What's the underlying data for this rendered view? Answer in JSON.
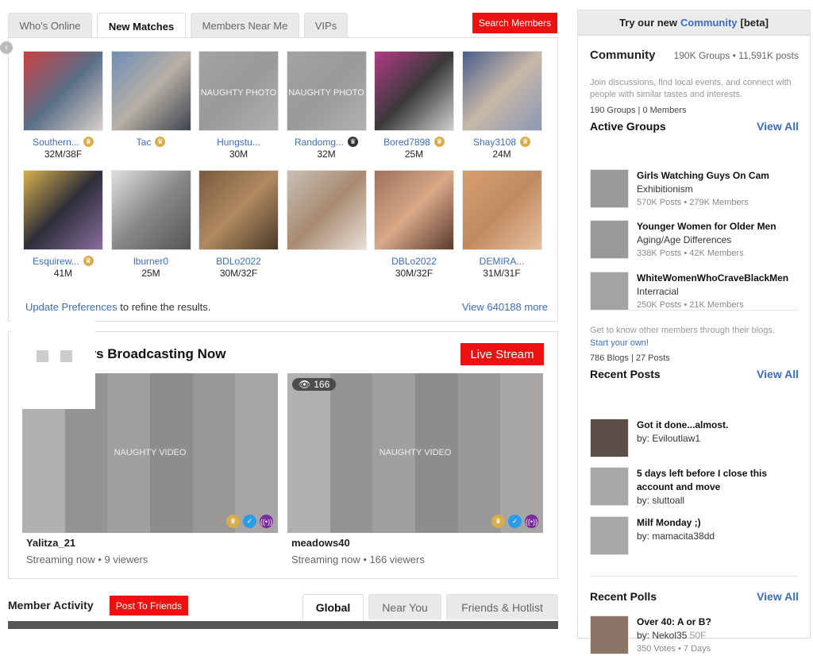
{
  "tabs": [
    {
      "label": "Who's Online",
      "active": false
    },
    {
      "label": "New Matches",
      "active": true
    },
    {
      "label": "Members Near Me",
      "active": false
    },
    {
      "label": "VIPs",
      "active": false
    }
  ],
  "search_button": "Search Members",
  "matches": [
    {
      "name": "Southern...",
      "age": "32M/38F",
      "badge": "gold-crown",
      "photo": "photo"
    },
    {
      "name": "Tac",
      "age": "",
      "badge": "gold-crown",
      "photo": "photo"
    },
    {
      "name": "Hungstu...",
      "age": "30M",
      "badge": "",
      "photo": "NAUGHTY PHOTO"
    },
    {
      "name": "Randomg...",
      "age": "32M",
      "badge": "dark-crown",
      "photo": "NAUGHTY PHOTO"
    },
    {
      "name": "Bored7898",
      "age": "25M",
      "badge": "gold-crown",
      "photo": "photo"
    },
    {
      "name": "Shay3108",
      "age": "24M",
      "badge": "gold-crown",
      "photo": "photo"
    },
    {
      "name": "Esquirew...",
      "age": "41M",
      "badge": "gold-crown",
      "photo": "photo"
    },
    {
      "name": "lburner0",
      "age": "25M",
      "badge": "",
      "photo": "photo"
    },
    {
      "name": "BDLo2022",
      "age": "30M/32F",
      "badge": "",
      "photo": "photo"
    },
    {
      "name": "",
      "age": "",
      "badge": "",
      "photo": "photo"
    },
    {
      "name": "DBLo2022",
      "age": "30M/32F",
      "badge": "",
      "photo": "photo"
    },
    {
      "name": "DEMIRA...",
      "age": "31M/31F",
      "badge": "",
      "photo": "photo"
    }
  ],
  "footer": {
    "update_link": "Update Preferences",
    "update_text": " to refine the results.",
    "view_more": "View 640188 more"
  },
  "broadcast": {
    "title": "ers Broadcasting Now",
    "live_button": "Live Stream",
    "streams": [
      {
        "name": "Yalitza_21",
        "meta": "Streaming now • 9 viewers",
        "label": "NAUGHTY VIDEO",
        "viewers": ""
      },
      {
        "name": "meadows40",
        "meta": "Streaming now • 166 viewers",
        "label": "NAUGHTY VIDEO",
        "viewers": "166"
      }
    ]
  },
  "activity": {
    "title": "Member Activity",
    "post_button": "Post To Friends",
    "tabs": [
      {
        "label": "Global",
        "active": true
      },
      {
        "label": "Near You",
        "active": false
      },
      {
        "label": "Friends & Hotlist",
        "active": false
      }
    ]
  },
  "sidebar": {
    "beta_prefix": "Try our new",
    "beta_link": "Community",
    "beta_suffix": "[beta]",
    "community_title": "Community",
    "community_stats": "190K Groups • 11,591K posts",
    "community_desc": "Join discussions, find local events, and connect with people with similar tastes and interests.",
    "community_counts": "190 Groups | 0 Members",
    "active_groups_title": "Active Groups",
    "view_all": "View All",
    "groups": [
      {
        "title": "Girls Watching Guys On Cam",
        "sub": "Exhibitionism",
        "meta": "570K Posts • 279K Members"
      },
      {
        "title": "Younger Women for Older Men",
        "sub": "Aging/Age Differences",
        "meta": "338K Posts • 42K Members"
      },
      {
        "title": "WhiteWomenWhoCraveBlackMen",
        "sub": "Interracial",
        "meta": "250K Posts • 21K Members"
      }
    ],
    "blogs_desc": "Get to know other members through their blogs.",
    "blogs_link": "Start your own!",
    "blogs_counts": "786 Blogs | 27 Posts",
    "recent_posts_title": "Recent Posts",
    "posts": [
      {
        "title": "Got it done...almost.",
        "by": "by: Eviloutlaw1"
      },
      {
        "title": "5 days left before I close this account and move",
        "by": "by: sluttoall"
      },
      {
        "title": "Milf Monday ;)",
        "by": "by: mamacita38dd"
      }
    ],
    "recent_polls_title": "Recent Polls",
    "polls": [
      {
        "title": "Over 40: A or B?",
        "by": "by: Nekol35",
        "age": "50F",
        "meta": "350 Votes • 7 Days"
      }
    ]
  }
}
